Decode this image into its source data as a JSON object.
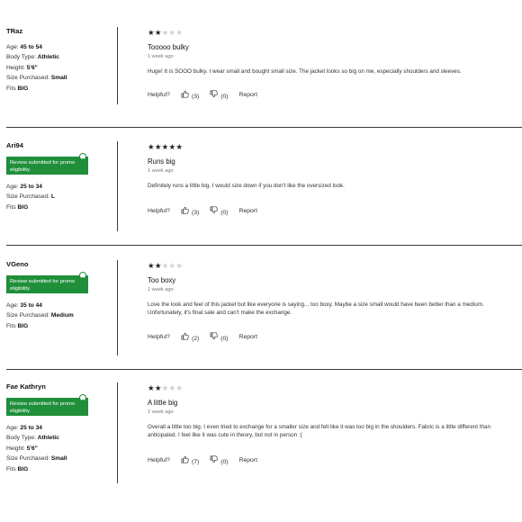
{
  "reviews": [
    {
      "username": "TRaz",
      "badge": null,
      "meta": [
        {
          "label": "Age: ",
          "value": "45 to 54"
        },
        {
          "label": "Body Type: ",
          "value": "Athletic"
        },
        {
          "label": "Height: ",
          "value": "5'6\""
        },
        {
          "label": "Size Purchased: ",
          "value": "Small"
        },
        {
          "label": "Fits ",
          "value": "BIG"
        }
      ],
      "rating": 2,
      "title": "Tooooo bulky",
      "date": "1 week ago",
      "body": "Huge! It is SOOO bulky. I wear small and bought small size. The jacket looks so big on me, especially shoulders and sleeves.",
      "helpful_label": "Helpful?",
      "up_count": "(3)",
      "down_count": "(0)",
      "report": "Report"
    },
    {
      "username": "Ari94",
      "badge": "Review submitted for promo eligibility.",
      "meta": [
        {
          "label": "Age: ",
          "value": "25 to 34"
        },
        {
          "label": "Size Purchased: ",
          "value": "L"
        },
        {
          "label": "Fits ",
          "value": "BIG"
        }
      ],
      "rating": 5,
      "title": "Runs big",
      "date": "1 week ago",
      "body": "Definitely runs a little big. I would size down if you don't like the oversized look.",
      "helpful_label": "Helpful?",
      "up_count": "(3)",
      "down_count": "(0)",
      "report": "Report"
    },
    {
      "username": "VGeno",
      "badge": "Review submitted for promo eligibility.",
      "meta": [
        {
          "label": "Age: ",
          "value": "35 to 44"
        },
        {
          "label": "Size Purchased: ",
          "value": "Medium"
        },
        {
          "label": "Fits ",
          "value": "BIG"
        }
      ],
      "rating": 2,
      "title": "Too boxy",
      "date": "1 week ago",
      "body": "Love the look and feel of this jacket but like everyone is saying... too boxy. Maybe a size small would have been better than a medium. Unfortunately, it's final sale and can't make the exchange.",
      "helpful_label": "Helpful?",
      "up_count": "(2)",
      "down_count": "(0)",
      "report": "Report"
    },
    {
      "username": "Fae Kathryn",
      "badge": "Review submitted for promo eligibility.",
      "meta": [
        {
          "label": "Age: ",
          "value": "25 to 34"
        },
        {
          "label": "Body Type: ",
          "value": "Athletic"
        },
        {
          "label": "Height: ",
          "value": "5'6\""
        },
        {
          "label": "Size Purchased: ",
          "value": "Small"
        },
        {
          "label": "Fits ",
          "value": "BIG"
        }
      ],
      "rating": 2,
      "title": "A little big",
      "date": "1 week ago",
      "body": "Overall a little too big. I even tried to exchange for a smaller size and felt like it was too big in the shoulders. Fabric is a little different than anticipated. I feel like it was cute in theory, but not in person :(",
      "helpful_label": "Helpful?",
      "up_count": "(7)",
      "down_count": "(0)",
      "report": "Report"
    }
  ],
  "icons": {
    "up": "thumbs-up-icon",
    "down": "thumbs-down-icon",
    "star": "star-icon",
    "pin": "location-pin-icon"
  },
  "colors": {
    "badge": "#1f8f3a",
    "star_on": "#222222",
    "star_off": "#cfcfcf",
    "divider": "#3a3a3a"
  }
}
